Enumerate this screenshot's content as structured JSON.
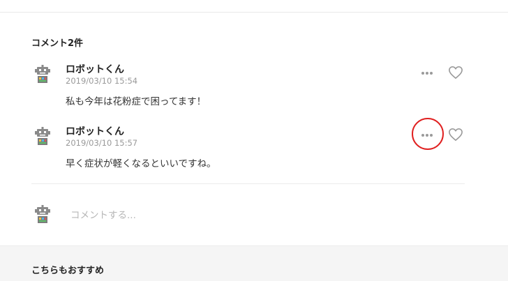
{
  "comments_section": {
    "title": "コメント2件",
    "comments": [
      {
        "author": "ロボットくん",
        "time": "2019/03/10 15:54",
        "body": "私も今年は花粉症で困ってます！"
      },
      {
        "author": "ロボットくん",
        "time": "2019/03/10 15:57",
        "body": "早く症状が軽くなるといいですね。"
      }
    ],
    "more_icon": "more-horizontal-icon",
    "like_icon": "heart-outline-icon",
    "highlight_color": "#e02020"
  },
  "comment_form": {
    "placeholder": "コメントする..."
  },
  "recommend": {
    "title": "こちらもおすすめ"
  }
}
